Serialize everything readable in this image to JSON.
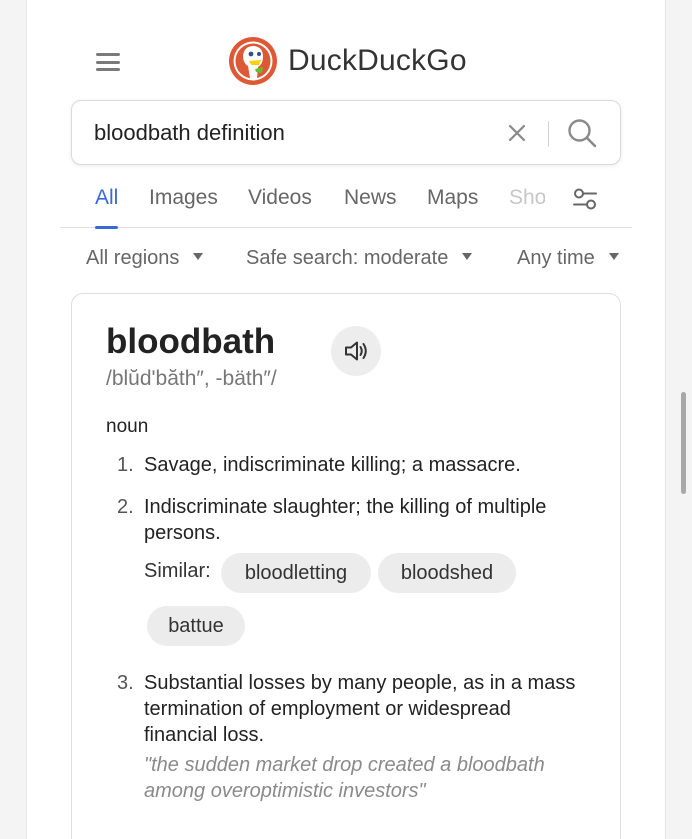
{
  "header": {
    "logo_text": "DuckDuckGo",
    "menu_icon": "hamburger-menu-icon"
  },
  "search": {
    "value": "bloodbath definition",
    "clear_icon": "close-icon",
    "submit_icon": "search-icon"
  },
  "tabs": [
    {
      "label": "All",
      "active": true
    },
    {
      "label": "Images"
    },
    {
      "label": "Videos"
    },
    {
      "label": "News"
    },
    {
      "label": "Maps"
    },
    {
      "label": "Shop"
    }
  ],
  "filters": {
    "region": "All regions",
    "safe_search": "Safe search: moderate",
    "time": "Any time"
  },
  "definition": {
    "word": "bloodbath",
    "pronunciation": "/blŭdʹbăth″, -bäth″/",
    "part_of_speech": "noun",
    "senses": [
      {
        "num": "1.",
        "text": "Savage, indiscriminate killing; a massacre."
      },
      {
        "num": "2.",
        "text": "Indiscriminate slaughter; the killing of multiple persons."
      },
      {
        "num": "3.",
        "text": "Substantial losses by many people, as in a mass termination of employment or widespread financial loss."
      }
    ],
    "similar_label": "Similar:",
    "similar": [
      "bloodletting",
      "bloodshed",
      "battue"
    ],
    "example": "\"the sudden market drop created a bloodbath among overoptimistic investors\""
  },
  "colors": {
    "accent": "#3969d6",
    "logo_orange": "#de5833"
  }
}
